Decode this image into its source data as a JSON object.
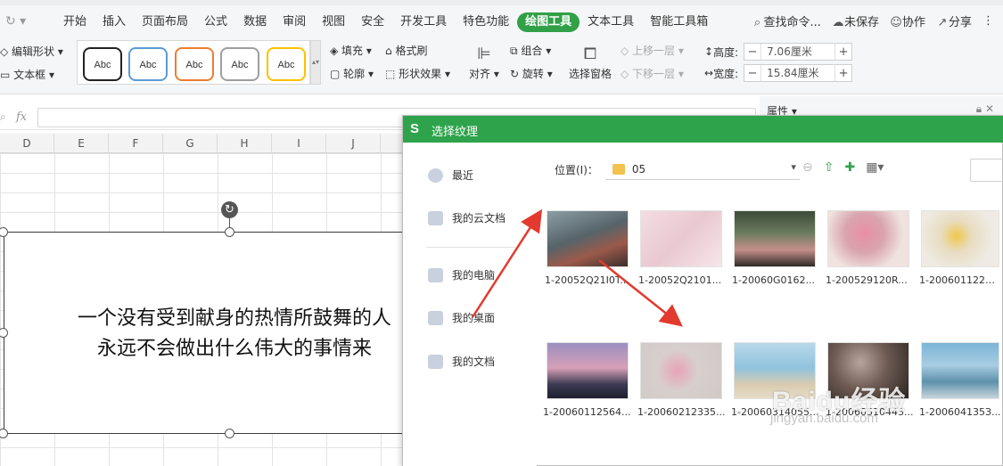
{
  "menubar": {
    "tabs": [
      {
        "label": "开始",
        "active": false
      },
      {
        "label": "插入",
        "active": false
      },
      {
        "label": "页面布局",
        "active": false
      },
      {
        "label": "公式",
        "active": false
      },
      {
        "label": "数据",
        "active": false
      },
      {
        "label": "审阅",
        "active": false
      },
      {
        "label": "视图",
        "active": false
      },
      {
        "label": "安全",
        "active": false
      },
      {
        "label": "开发工具",
        "active": false
      },
      {
        "label": "特色功能",
        "active": false
      },
      {
        "label": "绘图工具",
        "active": true
      },
      {
        "label": "文本工具",
        "active": false
      },
      {
        "label": "智能工具箱",
        "active": false
      }
    ],
    "search_label": "查找命令...",
    "unsaved_label": "未保存",
    "collab_label": "协作",
    "share_label": "分享",
    "accent_color": "#31a046"
  },
  "ribbon": {
    "edit_shape_label": "编辑形状",
    "text_box_label": "文本框",
    "style_swatches": [
      {
        "label": "Abc",
        "border": "#222222"
      },
      {
        "label": "Abc",
        "border": "#5b9bd5"
      },
      {
        "label": "Abc",
        "border": "#ed7d31"
      },
      {
        "label": "Abc",
        "border": "#9e9e9e"
      },
      {
        "label": "Abc",
        "border": "#ffc000"
      }
    ],
    "fill_label": "填充",
    "format_painter_label": "格式刷",
    "outline_label": "轮廓",
    "shape_effect_label": "形状效果",
    "align_label": "对齐",
    "group_label": "组合",
    "rotate_label": "旋转",
    "selection_pane_label": "选择窗格",
    "bring_forward_label": "上移一层",
    "send_backward_label": "下移一层",
    "height_label": "高度:",
    "height_value": "7.06厘米",
    "width_label": "宽度:",
    "width_value": "15.84厘米"
  },
  "formula": {
    "fx_label": "fx"
  },
  "sheet": {
    "columns": [
      "D",
      "E",
      "F",
      "G",
      "H",
      "I",
      "J"
    ],
    "shape_text_line1": "一个没有受到献身的热情所鼓舞的人",
    "shape_text_line2": "永远不会做出什么伟大的事情来"
  },
  "properties_pane": {
    "title": "属性"
  },
  "dialog": {
    "title": "选择纹理",
    "sidebar": [
      {
        "label": "最近"
      },
      {
        "label": "我的云文档"
      },
      {
        "label": "我的电脑"
      },
      {
        "label": "我的桌面"
      },
      {
        "label": "我的文档"
      }
    ],
    "location_label": "位置(I)：",
    "location_value": "05",
    "files": [
      {
        "name": "1-20052Q21I0T..."
      },
      {
        "name": "1-20052Q2101..."
      },
      {
        "name": "1-20060G0162..."
      },
      {
        "name": "1-200529120R..."
      },
      {
        "name": "1-200601122Q..."
      },
      {
        "name": "1-20060112564..."
      },
      {
        "name": "1-20060212335..."
      },
      {
        "name": "1-20060314055..."
      },
      {
        "name": "1-20060510443..."
      },
      {
        "name": "1-200604135З..."
      }
    ]
  },
  "watermark": {
    "brand": "Baidu经验",
    "url": "jingyan.baidu.com"
  }
}
